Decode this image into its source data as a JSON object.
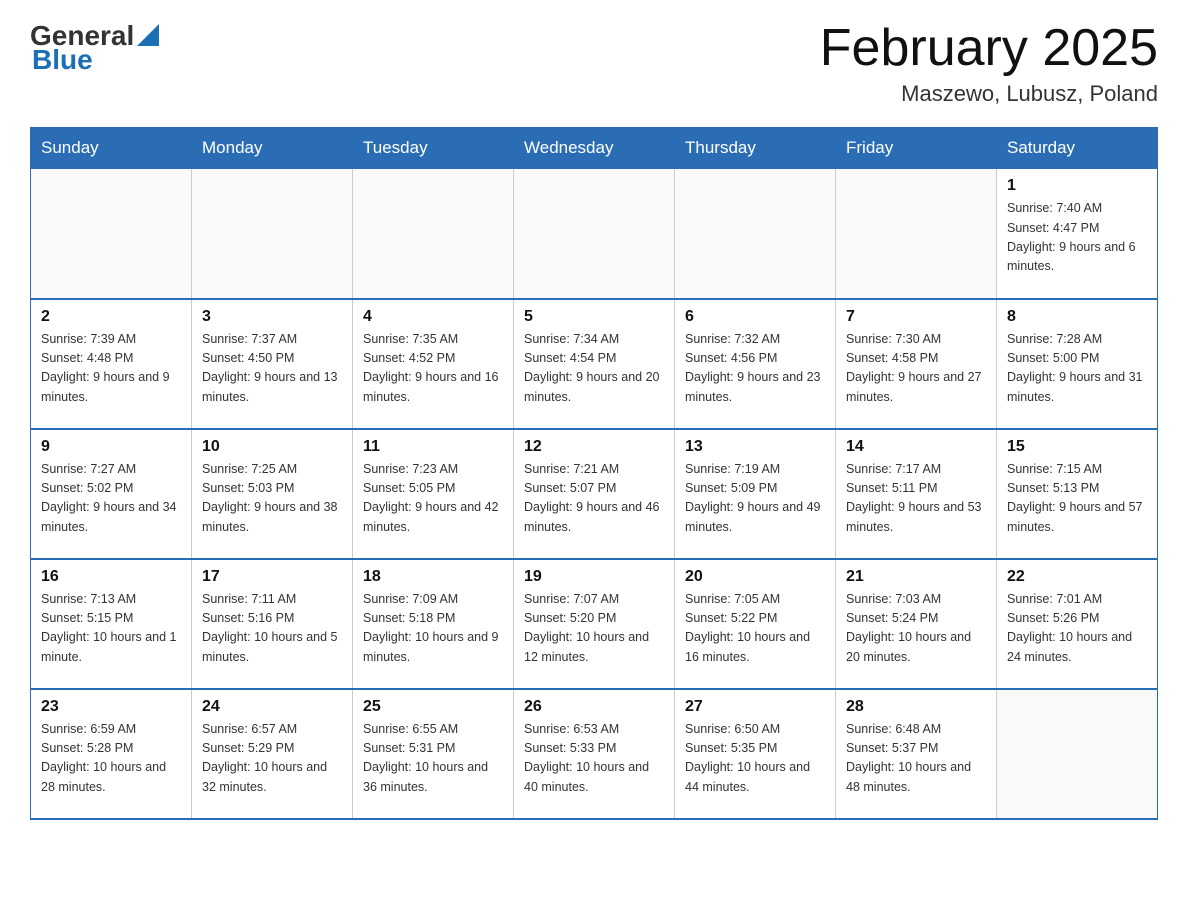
{
  "header": {
    "logo_general": "General",
    "logo_blue": "Blue",
    "title": "February 2025",
    "subtitle": "Maszewo, Lubusz, Poland"
  },
  "weekdays": [
    "Sunday",
    "Monday",
    "Tuesday",
    "Wednesday",
    "Thursday",
    "Friday",
    "Saturday"
  ],
  "weeks": [
    [
      {
        "day": "",
        "info": ""
      },
      {
        "day": "",
        "info": ""
      },
      {
        "day": "",
        "info": ""
      },
      {
        "day": "",
        "info": ""
      },
      {
        "day": "",
        "info": ""
      },
      {
        "day": "",
        "info": ""
      },
      {
        "day": "1",
        "info": "Sunrise: 7:40 AM\nSunset: 4:47 PM\nDaylight: 9 hours and 6 minutes."
      }
    ],
    [
      {
        "day": "2",
        "info": "Sunrise: 7:39 AM\nSunset: 4:48 PM\nDaylight: 9 hours and 9 minutes."
      },
      {
        "day": "3",
        "info": "Sunrise: 7:37 AM\nSunset: 4:50 PM\nDaylight: 9 hours and 13 minutes."
      },
      {
        "day": "4",
        "info": "Sunrise: 7:35 AM\nSunset: 4:52 PM\nDaylight: 9 hours and 16 minutes."
      },
      {
        "day": "5",
        "info": "Sunrise: 7:34 AM\nSunset: 4:54 PM\nDaylight: 9 hours and 20 minutes."
      },
      {
        "day": "6",
        "info": "Sunrise: 7:32 AM\nSunset: 4:56 PM\nDaylight: 9 hours and 23 minutes."
      },
      {
        "day": "7",
        "info": "Sunrise: 7:30 AM\nSunset: 4:58 PM\nDaylight: 9 hours and 27 minutes."
      },
      {
        "day": "8",
        "info": "Sunrise: 7:28 AM\nSunset: 5:00 PM\nDaylight: 9 hours and 31 minutes."
      }
    ],
    [
      {
        "day": "9",
        "info": "Sunrise: 7:27 AM\nSunset: 5:02 PM\nDaylight: 9 hours and 34 minutes."
      },
      {
        "day": "10",
        "info": "Sunrise: 7:25 AM\nSunset: 5:03 PM\nDaylight: 9 hours and 38 minutes."
      },
      {
        "day": "11",
        "info": "Sunrise: 7:23 AM\nSunset: 5:05 PM\nDaylight: 9 hours and 42 minutes."
      },
      {
        "day": "12",
        "info": "Sunrise: 7:21 AM\nSunset: 5:07 PM\nDaylight: 9 hours and 46 minutes."
      },
      {
        "day": "13",
        "info": "Sunrise: 7:19 AM\nSunset: 5:09 PM\nDaylight: 9 hours and 49 minutes."
      },
      {
        "day": "14",
        "info": "Sunrise: 7:17 AM\nSunset: 5:11 PM\nDaylight: 9 hours and 53 minutes."
      },
      {
        "day": "15",
        "info": "Sunrise: 7:15 AM\nSunset: 5:13 PM\nDaylight: 9 hours and 57 minutes."
      }
    ],
    [
      {
        "day": "16",
        "info": "Sunrise: 7:13 AM\nSunset: 5:15 PM\nDaylight: 10 hours and 1 minute."
      },
      {
        "day": "17",
        "info": "Sunrise: 7:11 AM\nSunset: 5:16 PM\nDaylight: 10 hours and 5 minutes."
      },
      {
        "day": "18",
        "info": "Sunrise: 7:09 AM\nSunset: 5:18 PM\nDaylight: 10 hours and 9 minutes."
      },
      {
        "day": "19",
        "info": "Sunrise: 7:07 AM\nSunset: 5:20 PM\nDaylight: 10 hours and 12 minutes."
      },
      {
        "day": "20",
        "info": "Sunrise: 7:05 AM\nSunset: 5:22 PM\nDaylight: 10 hours and 16 minutes."
      },
      {
        "day": "21",
        "info": "Sunrise: 7:03 AM\nSunset: 5:24 PM\nDaylight: 10 hours and 20 minutes."
      },
      {
        "day": "22",
        "info": "Sunrise: 7:01 AM\nSunset: 5:26 PM\nDaylight: 10 hours and 24 minutes."
      }
    ],
    [
      {
        "day": "23",
        "info": "Sunrise: 6:59 AM\nSunset: 5:28 PM\nDaylight: 10 hours and 28 minutes."
      },
      {
        "day": "24",
        "info": "Sunrise: 6:57 AM\nSunset: 5:29 PM\nDaylight: 10 hours and 32 minutes."
      },
      {
        "day": "25",
        "info": "Sunrise: 6:55 AM\nSunset: 5:31 PM\nDaylight: 10 hours and 36 minutes."
      },
      {
        "day": "26",
        "info": "Sunrise: 6:53 AM\nSunset: 5:33 PM\nDaylight: 10 hours and 40 minutes."
      },
      {
        "day": "27",
        "info": "Sunrise: 6:50 AM\nSunset: 5:35 PM\nDaylight: 10 hours and 44 minutes."
      },
      {
        "day": "28",
        "info": "Sunrise: 6:48 AM\nSunset: 5:37 PM\nDaylight: 10 hours and 48 minutes."
      },
      {
        "day": "",
        "info": ""
      }
    ]
  ]
}
